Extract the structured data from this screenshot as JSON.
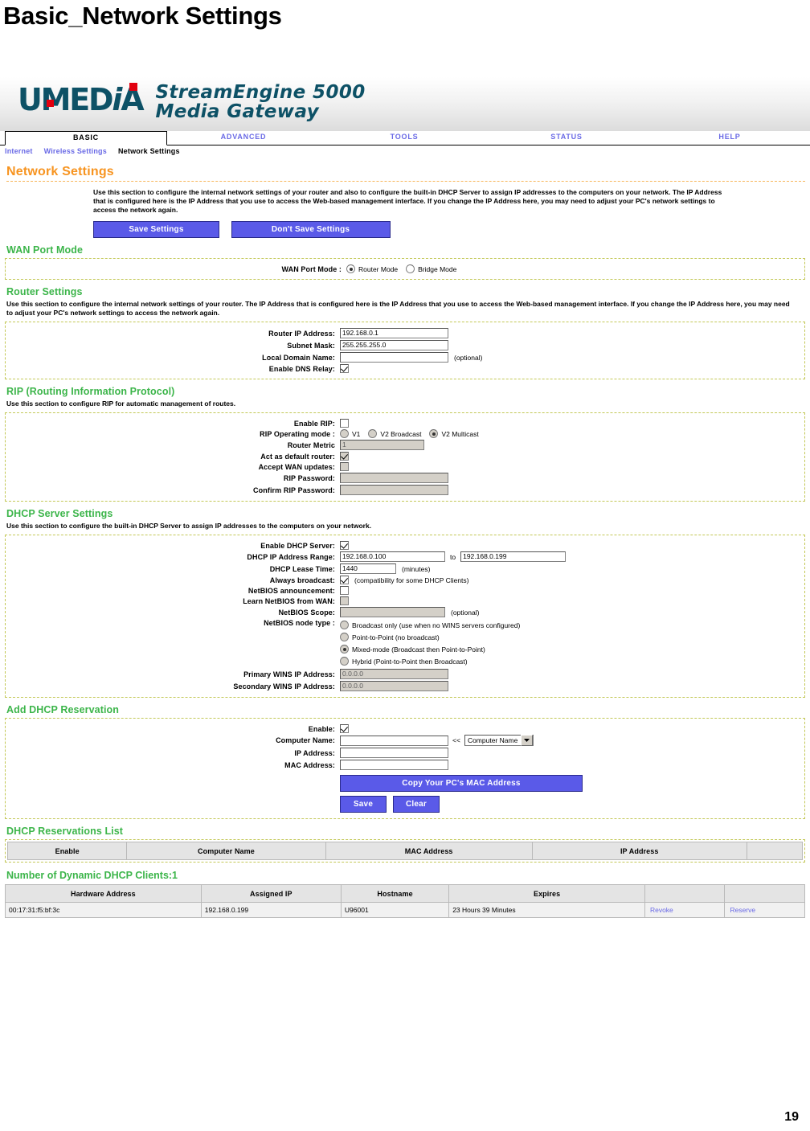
{
  "slide": {
    "title": "Basic_Network Settings",
    "page_number": "19"
  },
  "header": {
    "logo_u": "U",
    "logo_media": "MED",
    "logo_i": "i",
    "logo_a": "A",
    "product_line1": "StreamEngine 5000",
    "product_line2": "Media Gateway"
  },
  "tabs": [
    {
      "label": "BASIC",
      "active": true
    },
    {
      "label": "ADVANCED",
      "active": false
    },
    {
      "label": "TOOLS",
      "active": false
    },
    {
      "label": "STATUS",
      "active": false
    },
    {
      "label": "HELP",
      "active": false
    }
  ],
  "subnav": [
    {
      "label": "Internet",
      "current": false
    },
    {
      "label": "Wireless Settings",
      "current": false
    },
    {
      "label": "Network Settings",
      "current": true
    }
  ],
  "page": {
    "heading": "Network Settings",
    "intro": "Use this section to configure the internal network settings of your router and also to configure the built-in DHCP Server to assign IP addresses to the computers on your network. The IP Address that is configured here is the IP Address that you use to access the Web-based management interface. If you change the IP Address here, you may need to adjust your PC's network settings to access the network again.",
    "save_label": "Save Settings",
    "dont_save_label": "Don't Save Settings"
  },
  "wan_port_mode": {
    "title": "WAN Port Mode",
    "label": "WAN Port Mode :",
    "options": [
      {
        "label": "Router Mode",
        "selected": true
      },
      {
        "label": "Bridge Mode",
        "selected": false
      }
    ]
  },
  "router_settings": {
    "title": "Router Settings",
    "description": "Use this section to configure the internal network settings of your router. The IP Address that is configured here is the IP Address that you use to access the Web-based management interface. If you change the IP Address here, you may need to adjust your PC's network settings to access the network again.",
    "fields": {
      "router_ip_label": "Router IP Address:",
      "router_ip_value": "192.168.0.1",
      "subnet_label": "Subnet Mask:",
      "subnet_value": "255.255.255.0",
      "domain_label": "Local Domain Name:",
      "domain_value": "",
      "domain_hint": "(optional)",
      "dns_relay_label": "Enable DNS Relay:",
      "dns_relay_checked": true
    }
  },
  "rip": {
    "title": "RIP (Routing Information Protocol)",
    "description": "Use this section to configure RIP for automatic management of routes.",
    "enable_label": "Enable RIP:",
    "enable_checked": false,
    "mode_label": "RIP Operating mode :",
    "mode_options": [
      {
        "label": "V1",
        "selected": false
      },
      {
        "label": "V2 Broadcast",
        "selected": false
      },
      {
        "label": "V2 Multicast",
        "selected": true
      }
    ],
    "metric_label": "Router Metric",
    "metric_value": "1",
    "default_router_label": "Act as default router:",
    "default_router_checked": true,
    "accept_wan_label": "Accept WAN updates:",
    "accept_wan_checked": false,
    "password_label": "RIP Password:",
    "password_value": "",
    "confirm_password_label": "Confirm RIP Password:",
    "confirm_password_value": ""
  },
  "dhcp_server": {
    "title": "DHCP Server Settings",
    "description": "Use this section to configure the built-in DHCP Server to assign IP addresses to the computers on your network.",
    "enable_label": "Enable DHCP Server:",
    "enable_checked": true,
    "range_label": "DHCP IP Address Range:",
    "range_start": "192.168.0.100",
    "range_to": "to",
    "range_end": "192.168.0.199",
    "lease_label": "DHCP Lease Time:",
    "lease_value": "1440",
    "lease_hint": "(minutes)",
    "always_broadcast_label": "Always broadcast:",
    "always_broadcast_checked": true,
    "always_broadcast_hint": "(compatibility for some DHCP Clients)",
    "netbios_announce_label": "NetBIOS announcement:",
    "netbios_announce_checked": false,
    "learn_netbios_label": "Learn NetBIOS from WAN:",
    "learn_netbios_checked": false,
    "netbios_scope_label": "NetBIOS Scope:",
    "netbios_scope_value": "",
    "netbios_scope_hint": "(optional)",
    "node_type_label": "NetBIOS node type :",
    "node_type_options": [
      {
        "label": "Broadcast only (use when no WINS servers configured)",
        "selected": false
      },
      {
        "label": "Point-to-Point (no broadcast)",
        "selected": false
      },
      {
        "label": "Mixed-mode (Broadcast then Point-to-Point)",
        "selected": true
      },
      {
        "label": "Hybrid (Point-to-Point then Broadcast)",
        "selected": false
      }
    ],
    "primary_wins_label": "Primary WINS IP Address:",
    "primary_wins_value": "0.0.0.0",
    "secondary_wins_label": "Secondary WINS IP Address:",
    "secondary_wins_value": "0.0.0.0"
  },
  "add_reservation": {
    "title": "Add DHCP Reservation",
    "enable_label": "Enable:",
    "enable_checked": true,
    "computer_name_label": "Computer Name:",
    "computer_name_value": "",
    "arrow": "<<",
    "computer_name_select": "Computer Name",
    "ip_label": "IP Address:",
    "ip_value": "",
    "mac_label": "MAC Address:",
    "mac_value": "",
    "copy_mac_label": "Copy Your PC's MAC Address",
    "save_label": "Save",
    "clear_label": "Clear"
  },
  "reservations_list": {
    "title": "DHCP Reservations List",
    "columns": [
      "Enable",
      "Computer Name",
      "MAC Address",
      "IP Address",
      ""
    ],
    "rows": []
  },
  "dynamic_clients": {
    "title": "Number of Dynamic DHCP Clients:1",
    "columns": [
      "Hardware Address",
      "Assigned IP",
      "Hostname",
      "Expires",
      "",
      ""
    ],
    "rows": [
      {
        "hardware_address": "00:17:31:f5:bf:3c",
        "assigned_ip": "192.168.0.199",
        "hostname": "U96001",
        "expires": "23 Hours 39 Minutes",
        "revoke": "Revoke",
        "reserve": "Reserve"
      }
    ]
  },
  "colors": {
    "brand_teal": "#0d5166",
    "brand_red": "#e2000f",
    "heading_orange": "#f79420",
    "section_green": "#3cb54a",
    "link_blue": "#6a6ae6",
    "button_blue": "#5a5ae8",
    "panel_border": "#c3c857"
  }
}
